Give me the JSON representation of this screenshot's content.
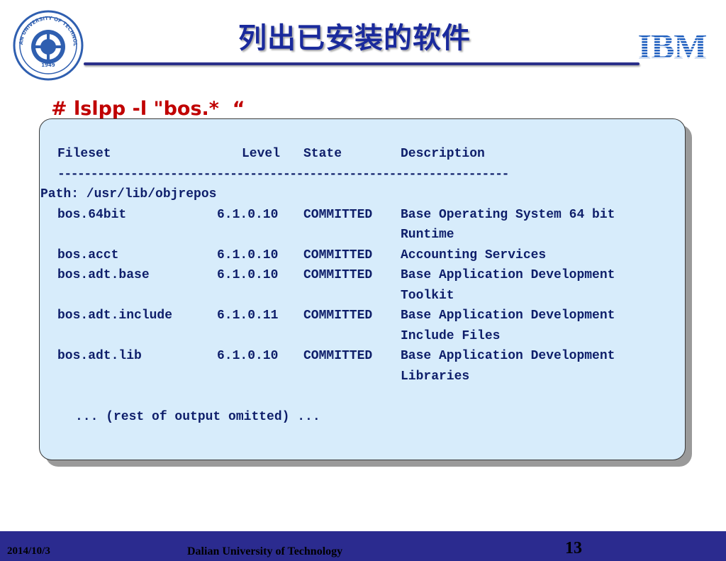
{
  "header": {
    "title": "列出已安装的软件",
    "logo_left_text": "DALIAN UNIVERSITY OF TECHNOLOGY",
    "logo_left_year": "1949",
    "logo_right": "IBM"
  },
  "command": "# lslpp -l \"bos.*  “",
  "terminal": {
    "headers": {
      "fileset": "Fileset",
      "level": "Level",
      "state": "State",
      "description": "Description"
    },
    "separator": "--------------------------------------------------------------------",
    "path": "Path: /usr/lib/objrepos",
    "rows": [
      {
        "fileset": "bos.64bit",
        "level": "6.1.0.10",
        "state": "COMMITTED",
        "desc1": "Base Operating System 64 bit",
        "desc2": "Runtime"
      },
      {
        "fileset": "bos.acct",
        "level": "6.1.0.10",
        "state": "COMMITTED",
        "desc1": "Accounting Services",
        "desc2": ""
      },
      {
        "fileset": "bos.adt.base",
        "level": "6.1.0.10",
        "state": "COMMITTED",
        "desc1": "Base Application Development",
        "desc2": "Toolkit"
      },
      {
        "fileset": "bos.adt.include",
        "level": "6.1.0.11",
        "state": "COMMITTED",
        "desc1": "Base Application Development",
        "desc2": "Include Files"
      },
      {
        "fileset": "bos.adt.lib",
        "level": "6.1.0.10",
        "state": "COMMITTED",
        "desc1": "Base Application Development",
        "desc2": "Libraries"
      }
    ],
    "omitted": "... (rest of output omitted) ..."
  },
  "footer": {
    "date": "2014/10/3",
    "organization": "Dalian University of Technology",
    "page_number": "13"
  },
  "colors": {
    "title": "#1a2a9c",
    "command": "#c00000",
    "terminal_bg": "#d7ecfb",
    "terminal_text": "#0e1e6a",
    "footer_bar": "#2b2b8f",
    "ibm_blue": "#1f5fbf"
  }
}
